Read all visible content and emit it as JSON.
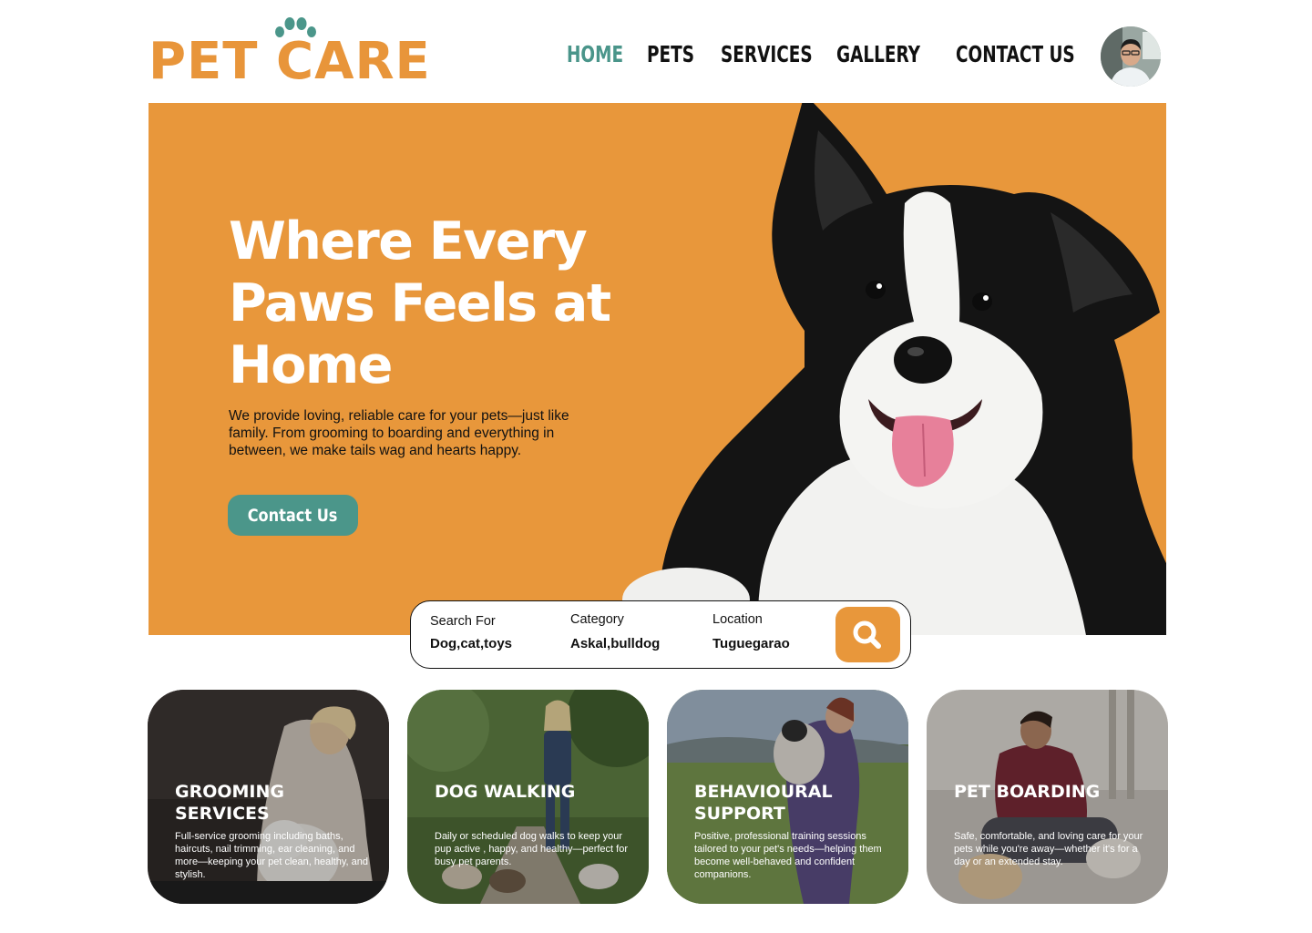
{
  "brand": {
    "logo_pet": "PET",
    "logo_care": "CARE",
    "primary_color": "#e8973b",
    "accent_color": "#4b968a"
  },
  "nav": {
    "items": [
      {
        "label": "HOME",
        "active": true
      },
      {
        "label": "PETS",
        "active": false
      },
      {
        "label": "SERVICES",
        "active": false
      },
      {
        "label": "GALLERY",
        "active": false
      },
      {
        "label": "CONTACT US",
        "active": false
      }
    ],
    "avatar_icon": "user-avatar"
  },
  "hero": {
    "title": "Where Every Paws Feels at Home",
    "description": "We provide loving, reliable care for your pets—just like family.  From grooming to boarding and everything in between, we make tails wag and hearts happy.",
    "cta_label": "Contact Us",
    "image": "dog-illustration"
  },
  "search": {
    "fields": [
      {
        "label": "Search For",
        "value": "Dog,cat,toys"
      },
      {
        "label": "Category",
        "value": "Askal,bulldog"
      },
      {
        "label": "Location",
        "value": "Tuguegarao"
      }
    ],
    "button_icon": "search-icon"
  },
  "services": [
    {
      "title": "GROOMING SERVICES",
      "description": "Full-service grooming including baths, haircuts, nail trimming, ear cleaning, and more—keeping your pet clean, healthy, and stylish."
    },
    {
      "title": "DOG WALKING",
      "description": "Daily or scheduled dog walks to keep your pup active , happy, and healthy—perfect for busy pet parents."
    },
    {
      "title": "BEHAVIOURAL SUPPORT",
      "description": "Positive, professional training sessions tailored to your pet's needs—helping them become well-behaved and confident companions."
    },
    {
      "title": "PET BOARDING",
      "description": "Safe, comfortable, and loving care for your pets while you're away—whether it's for a day or an extended stay."
    }
  ]
}
